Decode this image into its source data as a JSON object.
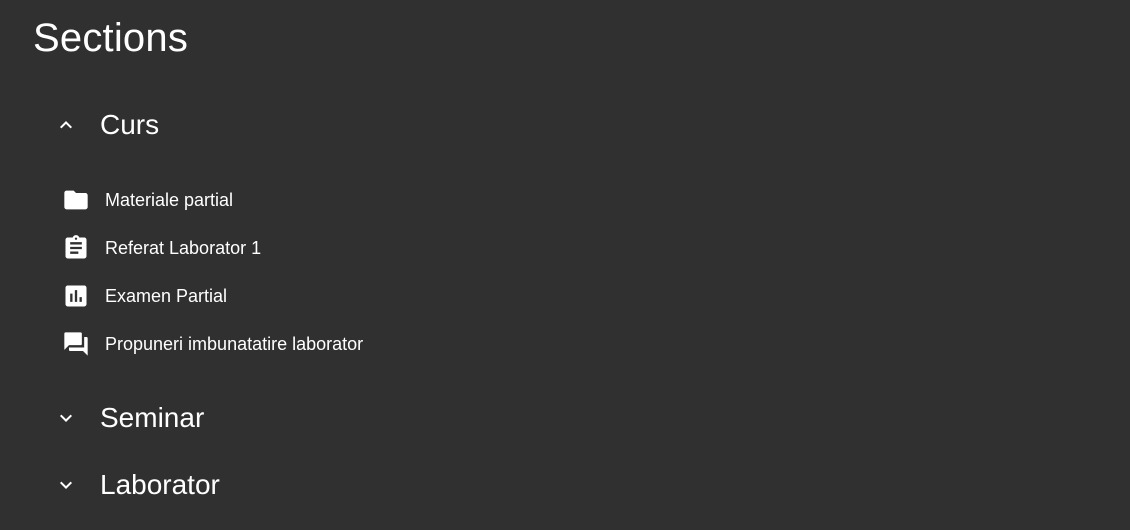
{
  "page_title": "Sections",
  "sections": [
    {
      "label": "Curs",
      "expanded": true,
      "items": [
        {
          "label": "Materiale partial",
          "icon": "folder-icon"
        },
        {
          "label": "Referat Laborator 1",
          "icon": "assignment-icon"
        },
        {
          "label": "Examen Partial",
          "icon": "bar-chart-icon"
        },
        {
          "label": "Propuneri imbunatatire laborator",
          "icon": "forum-icon"
        }
      ]
    },
    {
      "label": "Seminar",
      "expanded": false,
      "items": []
    },
    {
      "label": "Laborator",
      "expanded": false,
      "items": []
    }
  ],
  "colors": {
    "background": "#303030",
    "text": "#ffffff"
  }
}
